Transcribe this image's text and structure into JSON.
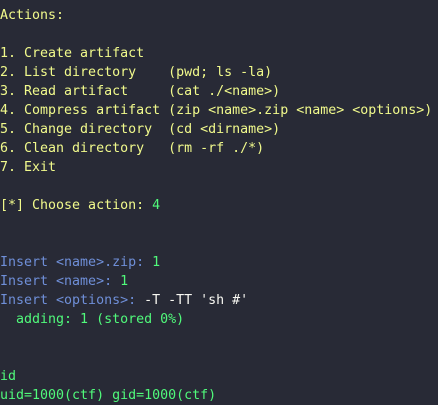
{
  "colors": {
    "background": "#282a36",
    "yellow": "#f1fa8c",
    "blue": "#6f8fd8",
    "green": "#50fa7b",
    "white": "#f8f8f2"
  },
  "lines": [
    {
      "segments": [
        {
          "text": "Actions:",
          "color": "yellow"
        }
      ]
    },
    {
      "segments": []
    },
    {
      "segments": [
        {
          "text": "1. Create artifact",
          "color": "yellow"
        }
      ]
    },
    {
      "segments": [
        {
          "text": "2. List directory    (pwd; ls -la)",
          "color": "yellow"
        }
      ]
    },
    {
      "segments": [
        {
          "text": "3. Read artifact     (cat ./<name>)",
          "color": "yellow"
        }
      ]
    },
    {
      "segments": [
        {
          "text": "4. Compress artifact (zip <name>.zip <name> <options>)",
          "color": "yellow"
        }
      ]
    },
    {
      "segments": [
        {
          "text": "5. Change directory  (cd <dirname>)",
          "color": "yellow"
        }
      ]
    },
    {
      "segments": [
        {
          "text": "6. Clean directory   (rm -rf ./*)",
          "color": "yellow"
        }
      ]
    },
    {
      "segments": [
        {
          "text": "7. Exit",
          "color": "yellow"
        }
      ]
    },
    {
      "segments": []
    },
    {
      "segments": [
        {
          "text": "[*] Choose action: ",
          "color": "yellow"
        },
        {
          "text": "4",
          "color": "green"
        }
      ]
    },
    {
      "segments": []
    },
    {
      "segments": []
    },
    {
      "segments": [
        {
          "text": "Insert <name>.zip: ",
          "color": "blue"
        },
        {
          "text": "1",
          "color": "green"
        }
      ]
    },
    {
      "segments": [
        {
          "text": "Insert <name>: ",
          "color": "blue"
        },
        {
          "text": "1",
          "color": "green"
        }
      ]
    },
    {
      "segments": [
        {
          "text": "Insert <options>: ",
          "color": "blue"
        },
        {
          "text": "-T -TT 'sh #'",
          "color": "white"
        }
      ]
    },
    {
      "segments": [
        {
          "text": "  adding: 1 (stored 0%)",
          "color": "green"
        }
      ]
    },
    {
      "segments": []
    },
    {
      "segments": []
    },
    {
      "segments": [
        {
          "text": "id",
          "color": "green"
        }
      ]
    },
    {
      "segments": [
        {
          "text": "uid=1000(ctf) gid=1000(ctf)",
          "color": "green"
        }
      ]
    }
  ]
}
